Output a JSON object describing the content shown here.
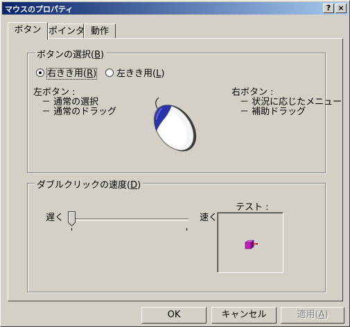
{
  "window": {
    "title": "マウスのプロパティ",
    "help_label": "?",
    "close_label": "×"
  },
  "tabs": [
    {
      "label": "ボタン",
      "active": true
    },
    {
      "label": "ポインタ",
      "active": false
    },
    {
      "label": "動作",
      "active": false
    }
  ],
  "button_config": {
    "group_label": "ボタンの選択",
    "group_hotkey": "B",
    "options": [
      {
        "label": "右きき用",
        "hotkey": "R",
        "selected": true
      },
      {
        "label": "左きき用",
        "hotkey": "L",
        "selected": false
      }
    ],
    "left_button": {
      "heading": "左ボタン :",
      "items": [
        "－ 通常の選択",
        "－ 通常のドラッグ"
      ]
    },
    "right_button": {
      "heading": "右ボタン :",
      "items": [
        "－ 状況に応じたメニュー",
        "－ 補助ドラッグ"
      ]
    }
  },
  "double_click": {
    "group_label": "ダブルクリックの速度",
    "group_hotkey": "D",
    "slow_label": "遅く",
    "fast_label": "速く",
    "slider_value": 0.0,
    "test_label": "テスト :"
  },
  "footer": {
    "ok_label": "OK",
    "cancel_label": "キャンセル",
    "apply_label": "適用",
    "apply_hotkey": "A"
  },
  "colors": {
    "title_gradient_start": "#0a246a",
    "title_gradient_end": "#a6caf0",
    "face": "#d4d0c8",
    "test_box_icon": "#b000b0"
  },
  "icons": {
    "mouse": "mouse-illustration-icon",
    "test_box": "jack-in-the-box-icon"
  }
}
